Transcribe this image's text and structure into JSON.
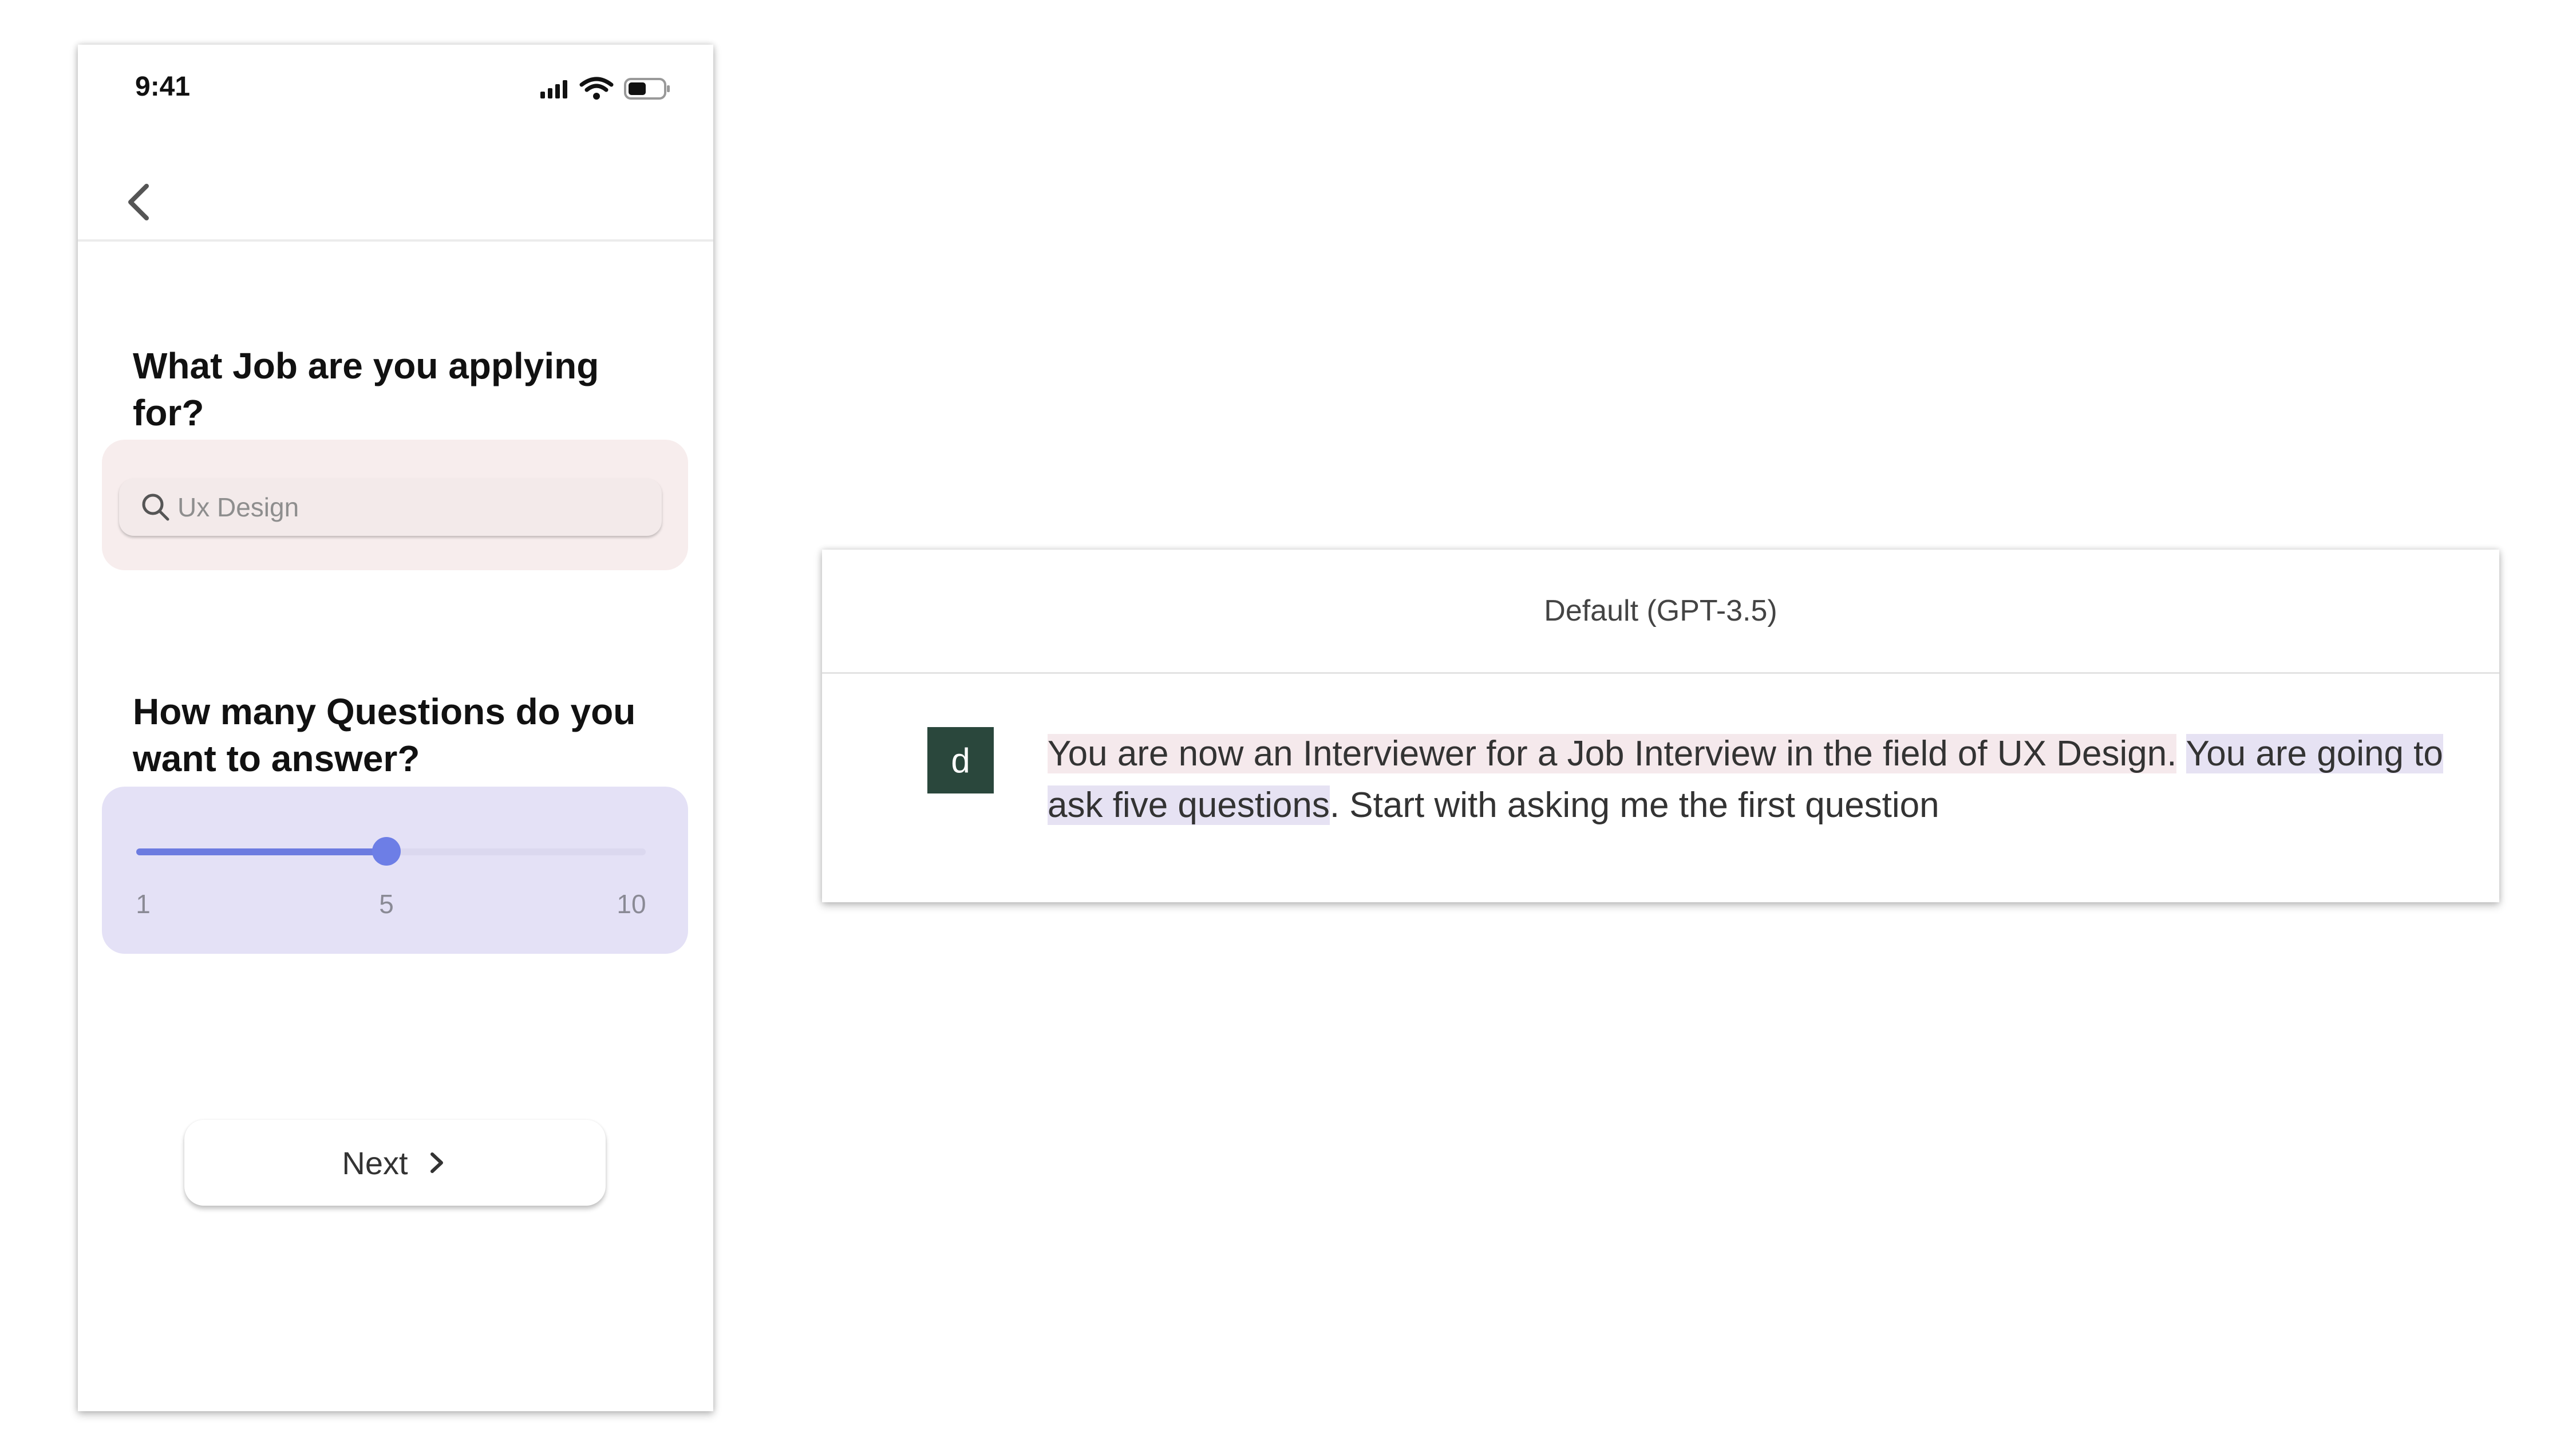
{
  "phone": {
    "status_bar": {
      "time": "9:41"
    },
    "job_question": "What Job are you applying for?",
    "job_search": {
      "value": "Ux Design"
    },
    "questions_prompt": "How many Questions do you want to answer?",
    "question_slider": {
      "min": 1,
      "max": 10,
      "value": 5,
      "tick_labels": [
        "1",
        "5",
        "10"
      ]
    },
    "next_button": {
      "label": "Next"
    }
  },
  "chat": {
    "model_title": "Default (GPT-3.5)",
    "avatar_letter": "d",
    "message_parts": [
      "You are now an Interviewer for a Job Interview in the field of UX Design.",
      " ",
      "You are going to ask five questions",
      ".",
      " Start with asking me the first question"
    ]
  },
  "colors": {
    "slider_accent": "#6c7be0",
    "job_card_bg": "#f7eded",
    "slider_card_bg": "#e4e1f6",
    "avatar_bg": "#2a473c",
    "highlight_pink": "#f5e9ec",
    "highlight_lavender": "#e6e2f3"
  },
  "icons": [
    "cellular-signal-icon",
    "wifi-icon",
    "battery-icon",
    "back-chevron-icon",
    "search-icon",
    "chevron-right-icon"
  ]
}
